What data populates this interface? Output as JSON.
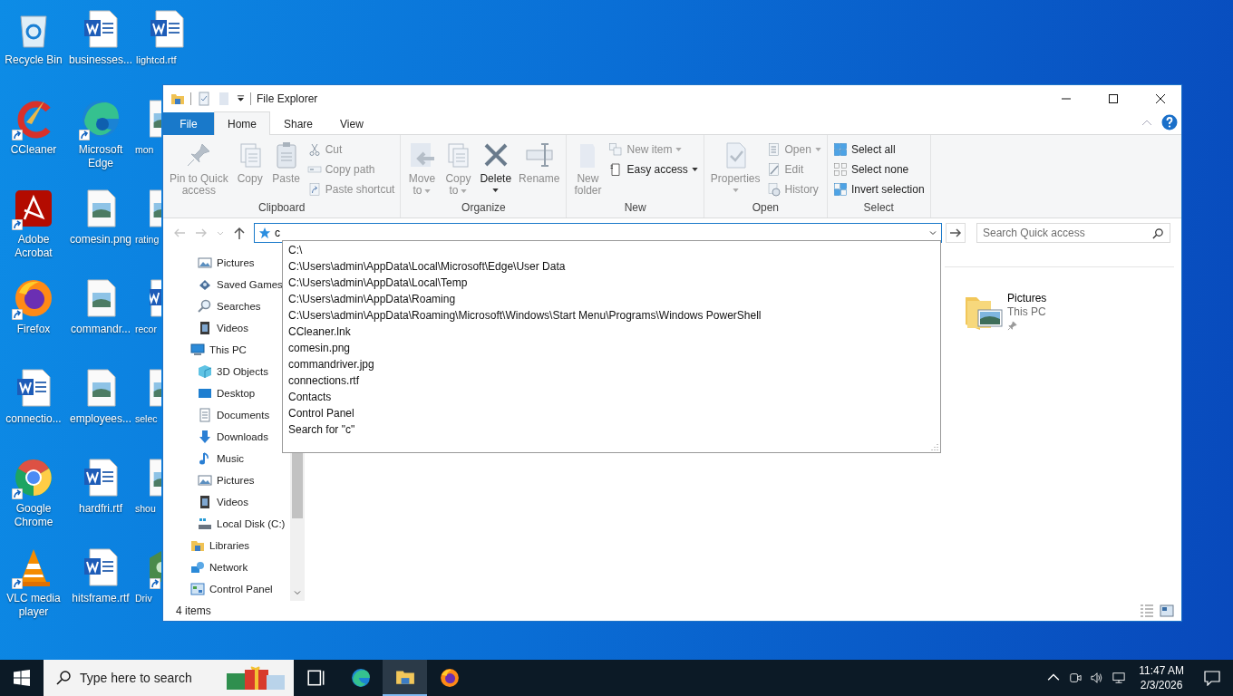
{
  "desktop": {
    "columns": [
      [
        {
          "label": "Recycle Bin",
          "shortcut": false
        },
        {
          "label": "CCleaner",
          "shortcut": true
        },
        {
          "label": "Adobe Acrobat",
          "shortcut": true
        },
        {
          "label": "Firefox",
          "shortcut": true
        },
        {
          "label": "connectio...",
          "shortcut": false
        },
        {
          "label": "Google Chrome",
          "shortcut": true
        },
        {
          "label": "VLC media player",
          "shortcut": true
        }
      ],
      [
        {
          "label": "businesses...",
          "shortcut": false
        },
        {
          "label": "Microsoft Edge",
          "shortcut": true
        },
        {
          "label": "comesin.png",
          "shortcut": false
        },
        {
          "label": "commandr...",
          "shortcut": false
        },
        {
          "label": "employees...",
          "shortcut": false
        },
        {
          "label": "hardfri.rtf",
          "shortcut": false
        },
        {
          "label": "hitsframe.rtf",
          "shortcut": false
        }
      ],
      [
        {
          "label": "lightcd.rtf",
          "shortcut": false
        },
        {
          "label": "mon",
          "shortcut": false
        },
        {
          "label": "rating",
          "shortcut": false
        },
        {
          "label": "recor",
          "shortcut": false
        },
        {
          "label": "selec",
          "shortcut": false
        },
        {
          "label": "shou",
          "shortcut": false
        },
        {
          "label": "Driv",
          "shortcut": true
        }
      ]
    ]
  },
  "window": {
    "title": "File Explorer",
    "tabs": [
      {
        "label": "File",
        "kind": "menu",
        "selected": false
      },
      {
        "label": "Home",
        "kind": "tab",
        "selected": true
      },
      {
        "label": "Share",
        "kind": "tab",
        "selected": false
      },
      {
        "label": "View",
        "kind": "tab",
        "selected": false
      }
    ],
    "ribbon": [
      {
        "label": "Clipboard",
        "buttons": [
          {
            "kind": "large",
            "lines": [
              "Pin to Quick",
              "access"
            ],
            "disabled": true,
            "dropdown": false
          },
          {
            "kind": "large",
            "lines": [
              "Copy"
            ],
            "disabled": true,
            "dropdown": false
          },
          {
            "kind": "large",
            "lines": [
              "Paste"
            ],
            "disabled": true,
            "dropdown": false
          },
          {
            "kind": "small",
            "lines": [
              "Cut"
            ],
            "disabled": true,
            "dropdown": false
          },
          {
            "kind": "small",
            "lines": [
              "Copy path"
            ],
            "disabled": true,
            "dropdown": false
          },
          {
            "kind": "small",
            "lines": [
              "Paste shortcut"
            ],
            "disabled": true,
            "dropdown": false
          }
        ]
      },
      {
        "label": "Organize",
        "buttons": [
          {
            "kind": "large",
            "lines": [
              "Move",
              "to"
            ],
            "disabled": true,
            "dropdown": true
          },
          {
            "kind": "large",
            "lines": [
              "Copy",
              "to"
            ],
            "disabled": true,
            "dropdown": true
          },
          {
            "kind": "large",
            "lines": [
              "Delete"
            ],
            "disabled": false,
            "dropdown": true
          },
          {
            "kind": "large",
            "lines": [
              "Rename"
            ],
            "disabled": true,
            "dropdown": false
          }
        ]
      },
      {
        "label": "New",
        "buttons": [
          {
            "kind": "large",
            "lines": [
              "New",
              "folder"
            ],
            "disabled": true,
            "dropdown": false
          },
          {
            "kind": "small",
            "lines": [
              "New item"
            ],
            "disabled": true,
            "dropdown": true
          },
          {
            "kind": "small",
            "lines": [
              "Easy access"
            ],
            "disabled": false,
            "dropdown": true
          }
        ]
      },
      {
        "label": "Open",
        "buttons": [
          {
            "kind": "large",
            "lines": [
              "Properties"
            ],
            "disabled": true,
            "dropdown": true
          },
          {
            "kind": "small",
            "lines": [
              "Open"
            ],
            "disabled": true,
            "dropdown": true
          },
          {
            "kind": "small",
            "lines": [
              "Edit"
            ],
            "disabled": true,
            "dropdown": false
          },
          {
            "kind": "small",
            "lines": [
              "History"
            ],
            "disabled": true,
            "dropdown": false
          }
        ]
      },
      {
        "label": "Select",
        "buttons": [
          {
            "kind": "small",
            "lines": [
              "Select all"
            ],
            "disabled": false,
            "dropdown": false
          },
          {
            "kind": "small",
            "lines": [
              "Select none"
            ],
            "disabled": false,
            "dropdown": false
          },
          {
            "kind": "small",
            "lines": [
              "Invert selection"
            ],
            "disabled": false,
            "dropdown": false
          }
        ]
      }
    ],
    "address_bar": {
      "value": "c",
      "suggestions": [
        "C:\\",
        "C:\\Users\\admin\\AppData\\Local\\Microsoft\\Edge\\User Data",
        "C:\\Users\\admin\\AppData\\Local\\Temp",
        "C:\\Users\\admin\\AppData\\Roaming",
        "C:\\Users\\admin\\AppData\\Roaming\\Microsoft\\Windows\\Start Menu\\Programs\\Windows PowerShell",
        "CCleaner.lnk",
        "comesin.png",
        "commandriver.jpg",
        "connections.rtf",
        "Contacts",
        "Control Panel",
        "Search for \"c\""
      ]
    },
    "search": {
      "placeholder": "Search Quick access"
    },
    "nav_pane": {
      "scrolled_group": {
        "children": [
          {
            "label": "Pictures"
          },
          {
            "label": "Saved Games"
          },
          {
            "label": "Searches"
          },
          {
            "label": "Videos"
          }
        ]
      },
      "items": [
        {
          "label": "This PC",
          "children": [
            {
              "label": "3D Objects"
            },
            {
              "label": "Desktop"
            },
            {
              "label": "Documents"
            },
            {
              "label": "Downloads"
            },
            {
              "label": "Music"
            },
            {
              "label": "Pictures"
            },
            {
              "label": "Videos"
            },
            {
              "label": "Local Disk (C:)"
            }
          ]
        },
        {
          "label": "Libraries"
        },
        {
          "label": "Network"
        },
        {
          "label": "Control Panel"
        }
      ]
    },
    "tiles": [
      {
        "name": "Pictures",
        "location": "This PC",
        "pinned": true
      }
    ],
    "status_bar": {
      "text": "4 items"
    }
  },
  "taskbar": {
    "search_placeholder": "Type here to search",
    "apps": [
      {
        "active": false
      },
      {
        "active": false
      },
      {
        "active": true
      },
      {
        "active": false
      }
    ],
    "time": "11:47 AM",
    "date": "2/3/2026"
  }
}
